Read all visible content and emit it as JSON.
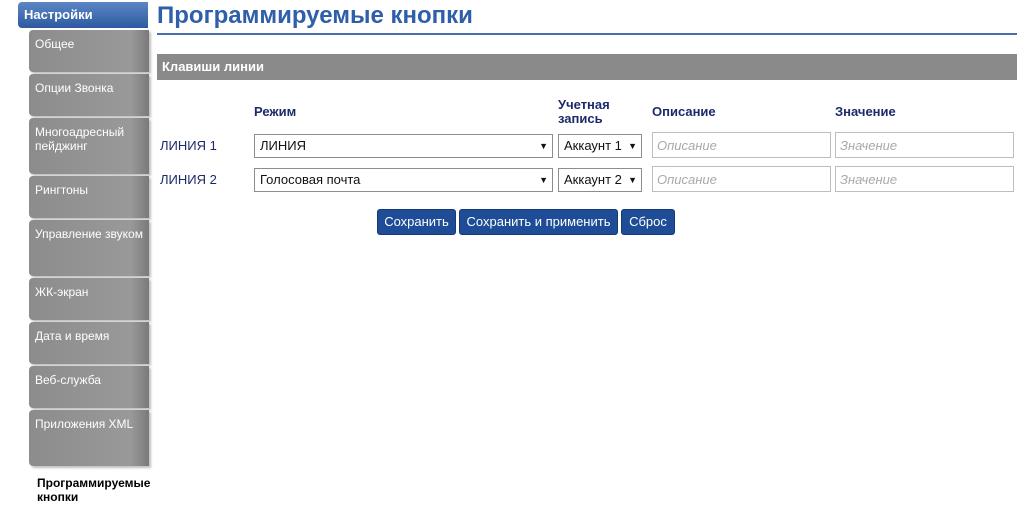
{
  "sidebar": {
    "header": "Настройки",
    "items": [
      {
        "label": "Общее"
      },
      {
        "label": "Опции Звонка"
      },
      {
        "label": "Многоадресный пейджинг"
      },
      {
        "label": "Рингтоны"
      },
      {
        "label": "Управление звуком"
      },
      {
        "label": "ЖК-экран"
      },
      {
        "label": "Дата и время"
      },
      {
        "label": "Веб-служба"
      },
      {
        "label": "Приложения XML"
      }
    ],
    "active": "Программируемые кнопки"
  },
  "page": {
    "title": "Программируемые кнопки"
  },
  "section": {
    "title": "Клавиши линии",
    "columns": {
      "mode": "Режим",
      "account": "Учетная запись",
      "description": "Описание",
      "value": "Значение"
    },
    "rows": [
      {
        "label": "ЛИНИЯ 1",
        "mode": "ЛИНИЯ",
        "account": "Аккаунт 1",
        "description_placeholder": "Описание",
        "value_placeholder": "Значение"
      },
      {
        "label": "ЛИНИЯ 2",
        "mode": "Голосовая почта",
        "account": "Аккаунт 2",
        "description_placeholder": "Описание",
        "value_placeholder": "Значение"
      }
    ]
  },
  "buttons": {
    "save": "Сохранить",
    "save_apply": "Сохранить и применить",
    "reset": "Сброс"
  },
  "icons": {
    "dropdown_arrow": "▼"
  },
  "colors": {
    "accent": "#2e5fa8",
    "button": "#1f4c96",
    "section_bar": "#8a8a8a",
    "sidebar_item": "#999999"
  }
}
